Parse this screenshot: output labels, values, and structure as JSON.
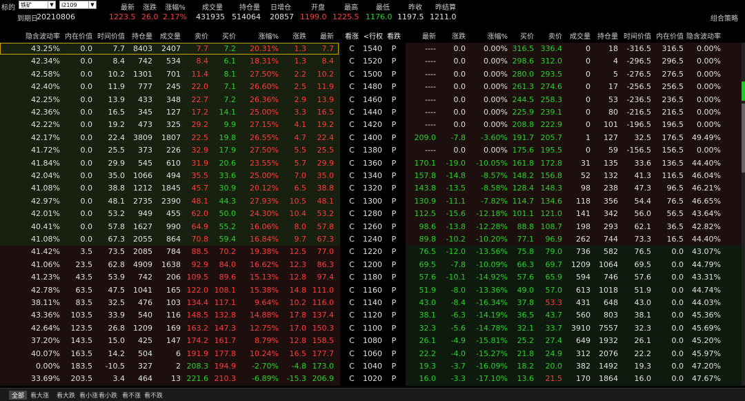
{
  "top": {
    "label": "标的",
    "sym": "铁矿",
    "contract": "i2109",
    "heads": [
      "最新",
      "涨跌",
      "涨幅%",
      "成交量",
      "持仓量",
      "日增仓",
      "开盘",
      "最高",
      "最低",
      "昨收",
      "昨结算"
    ]
  },
  "quote": {
    "expiry_label": "到期日",
    "expiry": "20210806",
    "last": "1223.5",
    "chg": "26.0",
    "pct": "2.17%",
    "vol": "431935",
    "oi": "514064",
    "oichg": "20857",
    "open": "1199.0",
    "high": "1225.5",
    "low": "1176.0",
    "prevclose": "1197.5",
    "prevsettle": "1211.0",
    "strategy": "组合策略"
  },
  "header": {
    "left": [
      "隐含波动率",
      "内在价值",
      "时间价值",
      "持仓量",
      "成交量",
      "卖价",
      "买价",
      "涨幅%",
      "涨跌",
      "最新"
    ],
    "mid": [
      "看涨",
      "<行权价>",
      "看跌"
    ],
    "right": [
      "最新",
      "涨跌",
      "涨幅%",
      "买价",
      "卖价",
      "成交量",
      "持仓量",
      "时间价值",
      "内在价值",
      "隐含波动率"
    ],
    "arrows": "‹ ›"
  },
  "rows": [
    [
      "43.25%",
      "0.0",
      "7.7",
      "8403",
      "2407",
      "7.7",
      "7.2",
      "20.31%",
      "1.3",
      "7.7",
      "C",
      "1540",
      "P",
      "----",
      "0.0",
      "0.00%",
      "316.5",
      "336.4",
      "0",
      "18",
      "-316.5",
      "316.5",
      "0.00%"
    ],
    [
      "42.34%",
      "0.0",
      "8.4",
      "742",
      "534",
      "8.4",
      "6.1",
      "18.31%",
      "1.3",
      "8.4",
      "C",
      "1520",
      "P",
      "----",
      "0.0",
      "0.00%",
      "298.6",
      "312.0",
      "0",
      "4",
      "-296.5",
      "296.5",
      "0.00%"
    ],
    [
      "42.58%",
      "0.0",
      "10.2",
      "1301",
      "701",
      "11.4",
      "8.1",
      "27.50%",
      "2.2",
      "10.2",
      "C",
      "1500",
      "P",
      "----",
      "0.0",
      "0.00%",
      "280.0",
      "293.5",
      "0",
      "5",
      "-276.5",
      "276.5",
      "0.00%"
    ],
    [
      "42.40%",
      "0.0",
      "11.9",
      "777",
      "245",
      "22.0",
      "7.1",
      "26.60%",
      "2.5",
      "11.9",
      "C",
      "1480",
      "P",
      "----",
      "0.0",
      "0.00%",
      "261.3",
      "274.6",
      "0",
      "17",
      "-256.5",
      "256.5",
      "0.00%"
    ],
    [
      "42.25%",
      "0.0",
      "13.9",
      "433",
      "348",
      "22.7",
      "7.2",
      "26.36%",
      "2.9",
      "13.9",
      "C",
      "1460",
      "P",
      "----",
      "0.0",
      "0.00%",
      "244.5",
      "258.3",
      "0",
      "53",
      "-236.5",
      "236.5",
      "0.00%"
    ],
    [
      "42.36%",
      "0.0",
      "16.5",
      "345",
      "127",
      "17.2",
      "14.1",
      "25.00%",
      "3.3",
      "16.5",
      "C",
      "1440",
      "P",
      "----",
      "0.0",
      "0.00%",
      "225.9",
      "239.1",
      "0",
      "80",
      "-216.5",
      "216.5",
      "0.00%"
    ],
    [
      "42.22%",
      "0.0",
      "19.2",
      "473",
      "325",
      "29.2",
      "9.9",
      "27.15%",
      "4.1",
      "19.2",
      "C",
      "1420",
      "P",
      "----",
      "0.0",
      "0.00%",
      "208.8",
      "222.9",
      "0",
      "101",
      "-196.5",
      "196.5",
      "0.00%"
    ],
    [
      "42.17%",
      "0.0",
      "22.4",
      "3809",
      "1807",
      "22.5",
      "19.8",
      "26.55%",
      "4.7",
      "22.4",
      "C",
      "1400",
      "P",
      "209.0",
      "-7.8",
      "-3.60%",
      "191.7",
      "205.7",
      "1",
      "127",
      "32.5",
      "176.5",
      "49.49%"
    ],
    [
      "41.72%",
      "0.0",
      "25.5",
      "373",
      "226",
      "32.9",
      "17.9",
      "27.50%",
      "5.5",
      "25.5",
      "C",
      "1380",
      "P",
      "----",
      "0.0",
      "0.00%",
      "175.6",
      "195.5",
      "0",
      "59",
      "-156.5",
      "156.5",
      "0.00%"
    ],
    [
      "41.84%",
      "0.0",
      "29.9",
      "545",
      "610",
      "31.9",
      "20.6",
      "23.55%",
      "5.7",
      "29.9",
      "C",
      "1360",
      "P",
      "170.1",
      "-19.0",
      "-10.05%",
      "161.8",
      "172.8",
      "31",
      "135",
      "33.6",
      "136.5",
      "44.40%"
    ],
    [
      "42.04%",
      "0.0",
      "35.0",
      "1066",
      "494",
      "35.5",
      "33.6",
      "25.00%",
      "7.0",
      "35.0",
      "C",
      "1340",
      "P",
      "157.8",
      "-14.8",
      "-8.57%",
      "148.2",
      "156.8",
      "52",
      "132",
      "41.3",
      "116.5",
      "46.04%"
    ],
    [
      "41.08%",
      "0.0",
      "38.8",
      "1212",
      "1845",
      "45.7",
      "30.9",
      "20.12%",
      "6.5",
      "38.8",
      "C",
      "1320",
      "P",
      "143.8",
      "-13.5",
      "-8.58%",
      "128.4",
      "148.3",
      "98",
      "238",
      "47.3",
      "96.5",
      "46.21%"
    ],
    [
      "42.97%",
      "0.0",
      "48.1",
      "2735",
      "2390",
      "48.1",
      "44.3",
      "27.93%",
      "10.5",
      "48.1",
      "C",
      "1300",
      "P",
      "130.9",
      "-11.1",
      "-7.82%",
      "114.7",
      "134.6",
      "118",
      "356",
      "54.4",
      "76.5",
      "46.65%"
    ],
    [
      "42.01%",
      "0.0",
      "53.2",
      "949",
      "455",
      "62.0",
      "50.0",
      "24.30%",
      "10.4",
      "53.2",
      "C",
      "1280",
      "P",
      "112.5",
      "-15.6",
      "-12.18%",
      "101.1",
      "121.0",
      "141",
      "342",
      "56.0",
      "56.5",
      "43.64%"
    ],
    [
      "40.41%",
      "0.0",
      "57.8",
      "1627",
      "990",
      "64.9",
      "55.2",
      "16.06%",
      "8.0",
      "57.8",
      "C",
      "1260",
      "P",
      "98.6",
      "-13.8",
      "-12.28%",
      "88.8",
      "108.7",
      "198",
      "293",
      "62.1",
      "36.5",
      "42.82%"
    ],
    [
      "41.08%",
      "0.0",
      "67.3",
      "2055",
      "864",
      "70.8",
      "59.4",
      "16.84%",
      "9.7",
      "67.3",
      "C",
      "1240",
      "P",
      "89.8",
      "-10.2",
      "-10.20%",
      "77.1",
      "96.9",
      "262",
      "744",
      "73.3",
      "16.5",
      "44.40%"
    ],
    [
      "41.42%",
      "3.5",
      "73.5",
      "2085",
      "784",
      "88.5",
      "70.2",
      "19.38%",
      "12.5",
      "77.0",
      "C",
      "1220",
      "P",
      "76.5",
      "-12.0",
      "-13.56%",
      "75.8",
      "79.0",
      "736",
      "582",
      "76.5",
      "0.0",
      "43.07%"
    ],
    [
      "41.06%",
      "23.5",
      "62.8",
      "4909",
      "1638",
      "92.9",
      "84.0",
      "16.62%",
      "12.3",
      "86.3",
      "C",
      "1200",
      "P",
      "69.5",
      "-7.8",
      "-10.09%",
      "66.3",
      "69.7",
      "1209",
      "1064",
      "69.5",
      "0.0",
      "44.79%"
    ],
    [
      "41.23%",
      "43.5",
      "53.9",
      "742",
      "206",
      "109.5",
      "89.6",
      "15.13%",
      "12.8",
      "97.4",
      "C",
      "1180",
      "P",
      "57.6",
      "-10.1",
      "-14.92%",
      "57.6",
      "65.9",
      "594",
      "746",
      "57.6",
      "0.0",
      "43.31%"
    ],
    [
      "42.78%",
      "63.5",
      "47.5",
      "1041",
      "165",
      "122.0",
      "108.1",
      "15.38%",
      "14.8",
      "111.0",
      "C",
      "1160",
      "P",
      "51.9",
      "-8.0",
      "-13.36%",
      "49.0",
      "57.0",
      "613",
      "1018",
      "51.9",
      "0.0",
      "44.74%"
    ],
    [
      "38.11%",
      "83.5",
      "32.5",
      "476",
      "103",
      "134.4",
      "117.1",
      "9.64%",
      "10.2",
      "116.0",
      "C",
      "1140",
      "P",
      "43.0",
      "-8.4",
      "-16.34%",
      "37.8",
      "53.3",
      "431",
      "648",
      "43.0",
      "0.0",
      "44.03%"
    ],
    [
      "43.36%",
      "103.5",
      "33.9",
      "540",
      "116",
      "148.5",
      "132.8",
      "14.88%",
      "17.8",
      "137.4",
      "C",
      "1120",
      "P",
      "38.1",
      "-6.3",
      "-14.19%",
      "36.5",
      "43.7",
      "560",
      "803",
      "38.1",
      "0.0",
      "45.36%"
    ],
    [
      "42.64%",
      "123.5",
      "26.8",
      "1209",
      "169",
      "163.2",
      "147.3",
      "12.75%",
      "17.0",
      "150.3",
      "C",
      "1100",
      "P",
      "32.3",
      "-5.6",
      "-14.78%",
      "32.1",
      "33.7",
      "3910",
      "7557",
      "32.3",
      "0.0",
      "45.69%"
    ],
    [
      "37.20%",
      "143.5",
      "15.0",
      "425",
      "147",
      "174.2",
      "161.7",
      "8.79%",
      "12.8",
      "158.5",
      "C",
      "1080",
      "P",
      "26.1",
      "-4.9",
      "-15.81%",
      "25.2",
      "27.4",
      "649",
      "1932",
      "26.1",
      "0.0",
      "45.20%"
    ],
    [
      "40.07%",
      "163.5",
      "14.2",
      "504",
      "6",
      "191.9",
      "177.8",
      "10.24%",
      "16.5",
      "177.7",
      "C",
      "1060",
      "P",
      "22.2",
      "-4.0",
      "-15.27%",
      "21.8",
      "24.9",
      "312",
      "2076",
      "22.2",
      "0.0",
      "45.97%"
    ],
    [
      "0.00%",
      "183.5",
      "-10.5",
      "327",
      "2",
      "208.3",
      "194.9",
      "-2.70%",
      "-4.8",
      "173.0",
      "C",
      "1040",
      "P",
      "19.3",
      "-3.7",
      "-16.09%",
      "18.2",
      "20.0",
      "382",
      "1492",
      "19.3",
      "0.0",
      "47.20%"
    ],
    [
      "33.69%",
      "203.5",
      "3.4",
      "464",
      "13",
      "221.6",
      "210.3",
      "-6.89%",
      "-15.3",
      "206.9",
      "C",
      "1020",
      "P",
      "16.0",
      "-3.3",
      "-17.10%",
      "13.6",
      "21.5",
      "170",
      "1864",
      "16.0",
      "0.0",
      "47.67%"
    ]
  ],
  "tabs": [
    "全部",
    "看大涨",
    "看大跌",
    "看小涨",
    "看小跌",
    "看不涨",
    "看不跌"
  ],
  "colors": {
    "itm_bg": "#191a12",
    "otm_put_bg": "#1e0f0f",
    "otm_call_bg": "#1e0f0f",
    "itm_put_bg": "#0d1a0d",
    "up": "#ff3c3c",
    "down": "#2ad12a"
  }
}
